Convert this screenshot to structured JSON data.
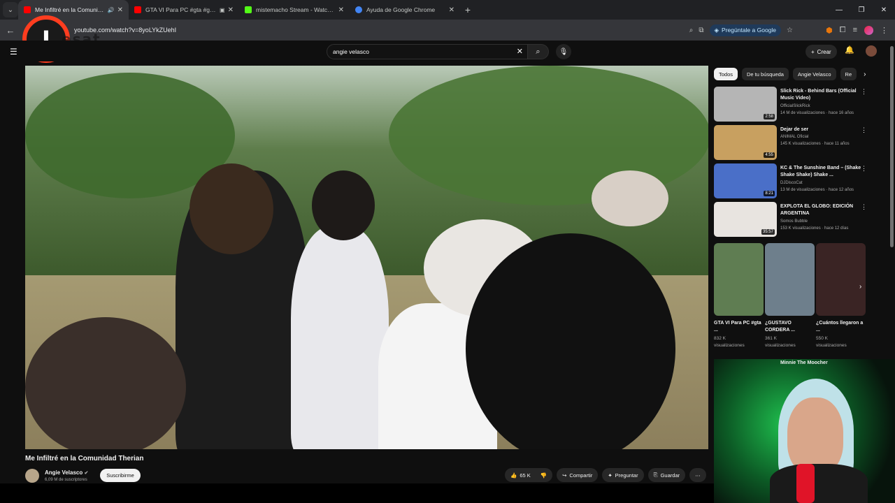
{
  "browser": {
    "tabs": [
      {
        "title": "Me Infiltré en la Comunidad",
        "favicon_color": "#ff0000",
        "active": true
      },
      {
        "title": "GTA VI Para PC #gta #grand",
        "favicon_color": "#ff0000",
        "active": false
      },
      {
        "title": "mistemacho Stream - Watch Li",
        "favicon_color": "#53fc18",
        "active": false
      },
      {
        "title": "Ayuda de Google Chrome",
        "favicon_color": "#4285f4",
        "active": false
      }
    ],
    "url": "youtube.com/watch?v=8yoLYkZUehI",
    "gemini_label": "Pregúntale a Google"
  },
  "watermark": {
    "letter": "I",
    "text": "esat"
  },
  "youtube": {
    "search_value": "angie velasco",
    "create_label": "Crear",
    "video": {
      "title": "Me Infiltré en la Comunidad Therian",
      "channel": "Angie Velasco",
      "subscribers": "6,09 M de suscriptores",
      "subscribe_label": "Suscribirme",
      "likes": "65 K",
      "share_label": "Compartir",
      "ask_label": "Preguntar",
      "save_label": "Guardar"
    },
    "chips": [
      "Todos",
      "De tu búsqueda",
      "Angie Velasco",
      "Re"
    ],
    "recommendations": [
      {
        "title": "Slick Rick - Behind Bars (Official Music Video)",
        "channel": "OfficialSlickRick",
        "meta": "14 M de visualizaciones · hace 16 años",
        "duration": "2:58",
        "thumb_color": "#b5b5b5"
      },
      {
        "title": "Dejar de ser",
        "channel": "ANIMAL Oficial",
        "meta": "145 K visualizaciones · hace 11 años",
        "duration": "4:55",
        "thumb_color": "#c8a060"
      },
      {
        "title": "KC & The Sunshine Band – (Shake Shake Shake) Shake ...",
        "channel": "DJDiscoCat",
        "meta": "13 M de visualizaciones · hace 12 años",
        "duration": "8:21",
        "thumb_color": "#4a6fc8"
      },
      {
        "title": "EXPLOTA EL GLOBO: EDICIÓN ARGENTINA",
        "channel": "Somos Bubble",
        "meta": "153 K visualizaciones · hace 12 días",
        "duration": "35:57",
        "thumb_color": "#e8e4e0"
      }
    ],
    "shorts": [
      {
        "title": "GTA VI Para PC #gta ...",
        "views": "832 K",
        "views_label": "visualizaciones",
        "color": "#5f7d52"
      },
      {
        "title": "¿GUSTAVO CORDERA ...",
        "views": "361 K",
        "views_label": "visualizaciones",
        "color": "#6e7f8c"
      },
      {
        "title": "¿Cuántos llegaron a ...",
        "views": "550 K",
        "views_label": "visualizaciones",
        "color": "#3a2424"
      }
    ],
    "partial_title": "Minnie The Moocher"
  }
}
